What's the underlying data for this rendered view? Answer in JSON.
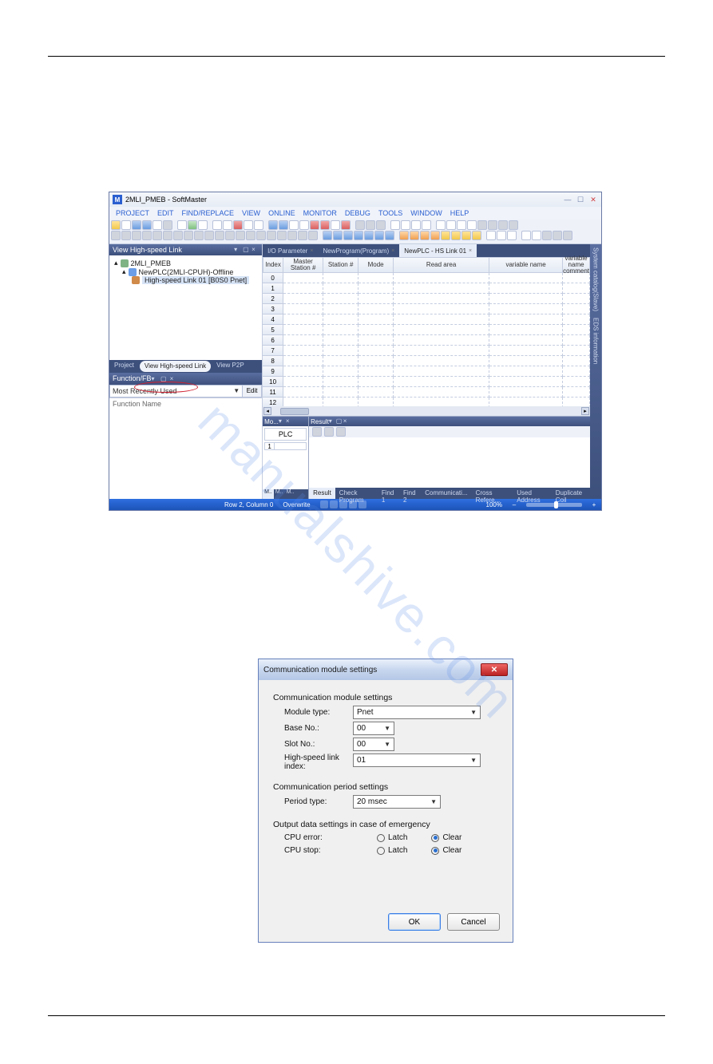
{
  "watermark": "manualshive.com",
  "app": {
    "title": "2MLI_PMEB - SoftMaster",
    "menus": [
      "PROJECT",
      "EDIT",
      "FIND/REPLACE",
      "VIEW",
      "ONLINE",
      "MONITOR",
      "DEBUG",
      "TOOLS",
      "WINDOW",
      "HELP"
    ],
    "wincontrols": {
      "min": "—",
      "max": "☐",
      "close": "✕"
    },
    "tree_panel": {
      "title": "View High-speed Link",
      "root": "2MLI_PMEB",
      "cpu": "NewPLC(2MLI-CPUH)-Offline",
      "hs": "High-speed Link 01 [B0S0 Pnet]",
      "tabs": [
        "Project",
        "View High-speed Link",
        "View P2P"
      ]
    },
    "func_panel": {
      "title": "Function/FB",
      "combo_value": "Most Recently Used",
      "edit_label": "Edit",
      "canvas_label": "Function Name"
    },
    "doc_tabs": [
      "I/O Parameter",
      "NewProgram(Program)",
      "NewPLC - HS Link 01"
    ],
    "grid_headers": [
      "Index",
      "Master Station #",
      "Station #",
      "Mode",
      "Read area",
      "variable name",
      "variable name comment"
    ],
    "grid_row_indices": [
      "0",
      "1",
      "2",
      "3",
      "4",
      "5",
      "6",
      "7",
      "8",
      "9",
      "10",
      "11",
      "12"
    ],
    "mo_dock": {
      "title": "Mo...",
      "cell": "PLC",
      "row1": "1",
      "tabs": [
        "M..",
        "M..",
        "M.."
      ]
    },
    "res_dock": {
      "title": "Result",
      "tabs": [
        "Result",
        "Check Program",
        "Find 1",
        "Find 2",
        "Communicati...",
        "Cross Refere...",
        "Used Address",
        "Duplicate Coil"
      ]
    },
    "right_rail": [
      "System catalog(Slave)",
      "EDS information"
    ],
    "status": {
      "pos": "Row 2, Column 0",
      "mode": "Overwrite",
      "zoom": "100%"
    }
  },
  "dialog": {
    "title": "Communication module settings",
    "g1_label": "Communication module settings",
    "module_type_label": "Module type:",
    "module_type_value": "Pnet",
    "base_label": "Base No.:",
    "base_value": "00",
    "slot_label": "Slot No.:",
    "slot_value": "00",
    "hsindex_label": "High-speed link index:",
    "hsindex_value": "01",
    "g2_label": "Communication period settings",
    "period_label": "Period type:",
    "period_value": "20 msec",
    "g3_label": "Output data settings in case of emergency",
    "cpu_error_label": "CPU error:",
    "cpu_stop_label": "CPU stop:",
    "latch_label": "Latch",
    "clear_label": "Clear",
    "ok": "OK",
    "cancel": "Cancel"
  }
}
